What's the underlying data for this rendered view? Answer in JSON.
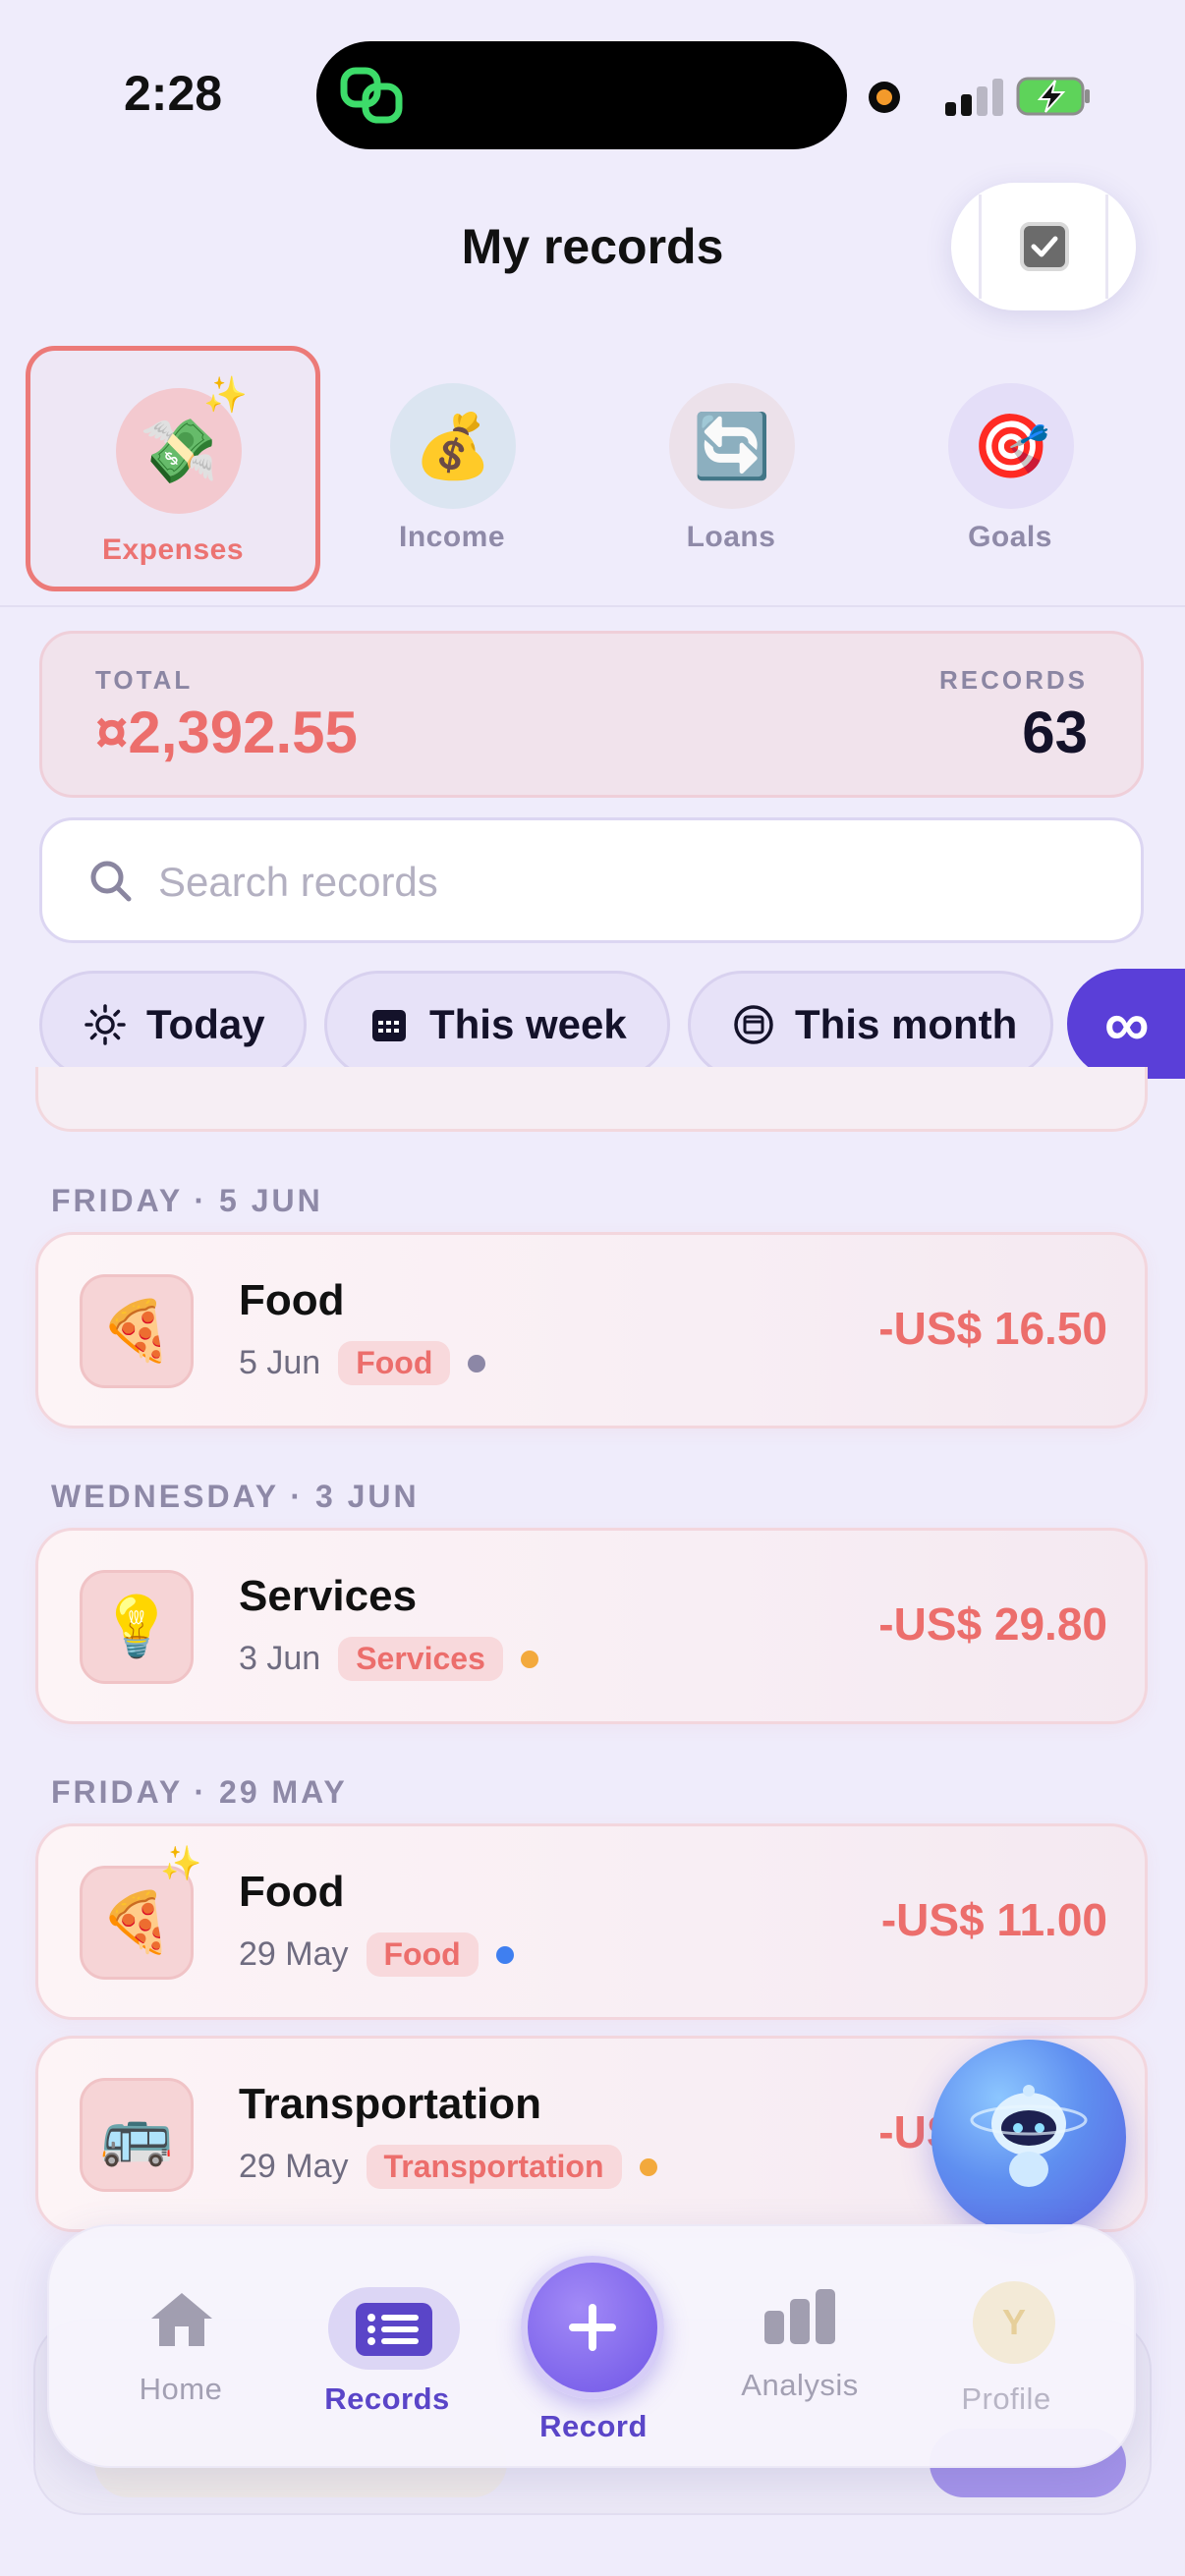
{
  "status_bar": {
    "time": "2:28"
  },
  "header": {
    "title": "My records"
  },
  "categories": [
    {
      "label": "Expenses",
      "icon": "money-wings-icon",
      "active": true
    },
    {
      "label": "Income",
      "icon": "money-bag-icon",
      "active": false
    },
    {
      "label": "Loans",
      "icon": "cycle-arrows-icon",
      "active": false
    },
    {
      "label": "Goals",
      "icon": "target-icon",
      "active": false
    }
  ],
  "summary": {
    "total_label": "TOTAL",
    "total_value": "¤2,392.55",
    "records_label": "RECORDS",
    "records_value": "63"
  },
  "search": {
    "placeholder": "Search records"
  },
  "filters": [
    {
      "label": "Today",
      "icon": "sun-icon"
    },
    {
      "label": "This week",
      "icon": "calendar-icon"
    },
    {
      "label": "This month",
      "icon": "calendar-month-icon"
    },
    {
      "label": "∞",
      "icon": "infinity-icon",
      "active": true
    }
  ],
  "groups": [
    {
      "day": "FRIDAY · 5 JUN",
      "records": [
        {
          "title": "Food",
          "date": "5 Jun",
          "tag": "Food",
          "amount": "-US$ 16.50",
          "dot_color": "#8c87a6",
          "icon": "pizza-icon"
        }
      ]
    },
    {
      "day": "WEDNESDAY · 3 JUN",
      "records": [
        {
          "title": "Services",
          "date": "3 Jun",
          "tag": "Services",
          "amount": "-US$ 29.80",
          "dot_color": "#f3a93c",
          "icon": "light-bulb-icon"
        }
      ]
    },
    {
      "day": "FRIDAY · 29 MAY",
      "records": [
        {
          "title": "Food",
          "date": "29 May",
          "tag": "Food",
          "amount": "-US$ 11.00",
          "dot_color": "#3f7ff0",
          "icon": "pizza-icon"
        },
        {
          "title": "Transportation",
          "date": "29 May",
          "tag": "Transportation",
          "amount": "-US$ 20.00",
          "dot_color": "#f3a93c",
          "icon": "bus-icon"
        }
      ]
    }
  ],
  "bottom_nav": [
    {
      "label": "Home",
      "icon": "home-icon"
    },
    {
      "label": "Records",
      "icon": "list-icon",
      "active": true
    },
    {
      "label": "Record",
      "icon": "plus-icon"
    },
    {
      "label": "Analysis",
      "icon": "bar-chart-icon"
    },
    {
      "label": "Profile",
      "icon": "avatar-icon",
      "avatar_initial": "Y"
    }
  ],
  "colors": {
    "accent": "#5a3fd8",
    "expense": "#ec6e6c",
    "background": "#efecfb"
  }
}
